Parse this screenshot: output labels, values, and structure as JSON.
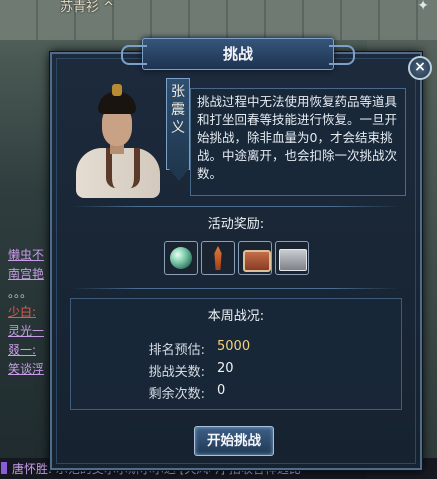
{
  "scene": {
    "top_label": "苏青衫 ^"
  },
  "chat": {
    "lines": [
      {
        "text": "懒虫不",
        "color": "#c99ee8"
      },
      {
        "text": "南宫艳",
        "color": "#c99ee8"
      },
      {
        "text": "。。。",
        "color": "#c7c7c7"
      },
      {
        "text": "少白:",
        "color": "#e05a4c"
      },
      {
        "text": "灵光一",
        "color": "#c99ee8"
      },
      {
        "text": "叕一:",
        "color": "#c99ee8"
      },
      {
        "text": "笑谈浮",
        "color": "#c99ee8"
      }
    ],
    "bottom_text": "唐怀胜: 示范的艾尔尔斯尔尔达 [天风吟] 招收各样选比"
  },
  "dialog": {
    "title": "挑战",
    "close_label": "×",
    "npc_name": "张震义",
    "description": "挑战过程中无法使用恢复药品等道具和打坐回春等技能进行恢复。一旦开始挑战，除非血量为0，才会结束挑战。中途离开，也会扣除一次挑战次数。",
    "rewards_title": "活动奖励:",
    "rewards": [
      {
        "icon": "orb-icon"
      },
      {
        "icon": "tower-icon"
      },
      {
        "icon": "chest-icon"
      },
      {
        "icon": "box-icon"
      }
    ],
    "status_title": "本周战况:",
    "stats": [
      {
        "label": "排名预估:",
        "value": "5000",
        "highlight": true
      },
      {
        "label": "挑战关数:",
        "value": "20",
        "highlight": false
      },
      {
        "label": "剩余次数:",
        "value": "0",
        "highlight": false
      }
    ],
    "start_button": "开始挑战"
  }
}
